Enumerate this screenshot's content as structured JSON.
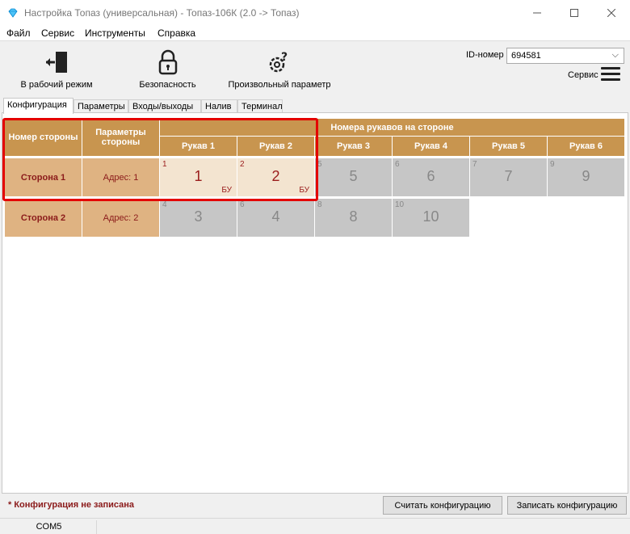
{
  "window": {
    "title": "Настройка Топаз (универсальная) - Топаз-106К (2.0 -> Топаз)"
  },
  "menu": [
    "Файл",
    "Сервис",
    "Инструменты",
    "Справка"
  ],
  "toolbar": {
    "work_mode": "В рабочий режим",
    "security": "Безопасность",
    "custom_param": "Произвольный параметр",
    "id_label": "ID-номер",
    "id_value": "694581",
    "service_label": "Сервис"
  },
  "tabs": [
    "Конфигурация",
    "Параметры",
    "Входы/выходы",
    "Налив",
    "Терминал"
  ],
  "grid": {
    "col_side_number": "Номер стороны",
    "col_side_params": "Параметры стороны",
    "hoses_header": "Номера рукавов на стороне",
    "hose_headers": [
      "Рукав 1",
      "Рукав 2",
      "Рукав 3",
      "Рукав 4",
      "Рукав 5",
      "Рукав 6"
    ],
    "sides": [
      {
        "name": "Сторона 1",
        "address": "Адрес: 1",
        "hoses": [
          {
            "small": "1",
            "big": "1",
            "tag": "БУ"
          },
          {
            "small": "2",
            "big": "2",
            "tag": "БУ"
          },
          {
            "small": "5",
            "big": "5",
            "tag": ""
          },
          {
            "small": "6",
            "big": "6",
            "tag": ""
          },
          {
            "small": "7",
            "big": "7",
            "tag": ""
          },
          {
            "small": "9",
            "big": "9",
            "tag": ""
          }
        ]
      },
      {
        "name": "Сторона 2",
        "address": "Адрес: 2",
        "hoses": [
          {
            "small": "4",
            "big": "3",
            "tag": ""
          },
          {
            "small": "6",
            "big": "4",
            "tag": ""
          },
          {
            "small": "8",
            "big": "8",
            "tag": ""
          },
          {
            "small": "10",
            "big": "10",
            "tag": ""
          }
        ]
      }
    ]
  },
  "footer": {
    "warning": "* Конфигурация не записана",
    "read_button": "Считать конфигурацию",
    "write_button": "Записать конфигурацию",
    "port": "COM5"
  }
}
